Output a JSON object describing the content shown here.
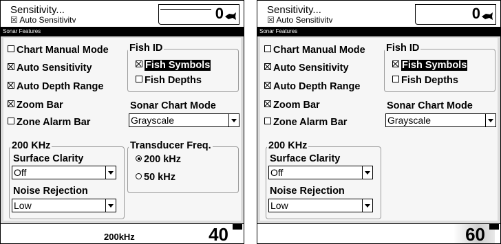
{
  "screens": [
    {
      "top_label1": "Sensitivity...",
      "top_label2": "☒ Auto Sensitivity",
      "depth": "0",
      "title": "Sonar Features",
      "checks": [
        {
          "label": "Chart Manual Mode",
          "checked": false
        },
        {
          "label": "Auto Sensitivity",
          "checked": true
        },
        {
          "label": "Auto Depth Range",
          "checked": true
        },
        {
          "label": "Zoom Bar",
          "checked": true
        },
        {
          "label": "Zone Alarm Bar",
          "checked": false
        }
      ],
      "fish_id": {
        "title": "Fish ID",
        "symbols": "Fish Symbols",
        "depths": "Fish Depths"
      },
      "chart_mode": {
        "label": "Sonar Chart Mode",
        "value": "Grayscale"
      },
      "khz_group": {
        "title": "200 KHz",
        "clarity_label": "Surface Clarity",
        "clarity_value": "Off",
        "noise_label": "Noise Rejection",
        "noise_value": "Low"
      },
      "transducer": {
        "title": "Transducer Freq.",
        "opt1": "200 kHz",
        "opt2": "50 kHz"
      },
      "bottom_freq": "200kHz",
      "bottom_num": "40"
    },
    {
      "top_label1": "Sensitivity...",
      "top_label2": "☒ Auto Sensitivity",
      "depth": "0",
      "title": "Sonar Features",
      "checks": [
        {
          "label": "Chart Manual Mode",
          "checked": false
        },
        {
          "label": "Auto Sensitivity",
          "checked": true
        },
        {
          "label": "Auto Depth Range",
          "checked": true
        },
        {
          "label": "Zoom Bar",
          "checked": true
        },
        {
          "label": "Zone Alarm Bar",
          "checked": false
        }
      ],
      "fish_id": {
        "title": "Fish ID",
        "symbols": "Fish Symbols",
        "depths": "Fish Depths"
      },
      "chart_mode": {
        "label": "Sonar Chart Mode",
        "value": "Grayscale"
      },
      "khz_group": {
        "title": "200 KHz",
        "clarity_label": "Surface Clarity",
        "clarity_value": "Off",
        "noise_label": "Noise Rejection",
        "noise_value": "Low"
      },
      "bottom_num": "60"
    }
  ]
}
